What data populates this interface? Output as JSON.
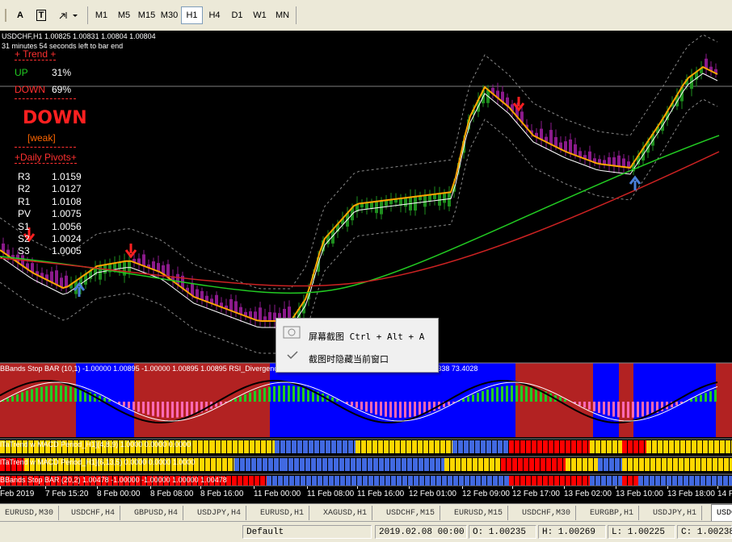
{
  "toolbar": {
    "timeframes": [
      "M1",
      "M5",
      "M15",
      "M30",
      "H1",
      "H4",
      "D1",
      "W1",
      "MN"
    ],
    "selected_timeframe": "H1",
    "text_tool_label": "A",
    "text_label_tool_label": "T"
  },
  "chart": {
    "header": "USDCHF,H1  1.00825 1.00831 1.00804 1.00804",
    "countdown": "31 minutes 54 seconds left to bar end",
    "trend_title": "+  Trend  +",
    "up_label": "UP",
    "up_value": "31%",
    "down_label": "DOWN",
    "down_value": "69%",
    "signal": "DOWN",
    "strength": "[weak]",
    "pivots_title": "+Daily Pivots+",
    "pivots": [
      {
        "name": "R3",
        "value": "1.0159"
      },
      {
        "name": "R2",
        "value": "1.0127"
      },
      {
        "name": "R1",
        "value": "1.0108"
      },
      {
        "name": "PV",
        "value": "1.0075"
      },
      {
        "name": "S1",
        "value": "1.0056"
      },
      {
        "name": "S2",
        "value": "1.0024"
      },
      {
        "name": "S3",
        "value": "1.0005"
      }
    ],
    "indicator_label": "BBands Stop BAR (10,1) -1.00000 1.00895 -1.00000 1.00895 1.00895  RSI_Divergence(7) 0.0000 0.0000 84.3293604  Stoch(8,3,5) 59.6338 73.4028",
    "sub2_label": "lTaTrend w MACD  Period_H1](4,8,9) 1.0000 0.0000 0.0000",
    "sub3_label": "lTaTrend w MACD  Period_H1](6,13,5) 0.0000 0.0000 1.0000",
    "sub4_label": "BBands Stop BAR (20,2) 1.00478 -1.00000 -1.00000 1.00000 1.00478"
  },
  "popup": {
    "item1": "屏幕截图 Ctrl + Alt + A",
    "item2": "截图时隐藏当前窗口"
  },
  "time_axis": [
    "Feb 2019",
    "7 Feb 15:20",
    "8 Feb 00:00",
    "8 Feb 08:00",
    "8 Feb 16:00",
    "11 Feb 00:00",
    "11 Feb 08:00",
    "11 Feb 16:00",
    "12 Feb 01:00",
    "12 Feb 09:00",
    "12 Feb 17:00",
    "13 Feb 02:00",
    "13 Feb 10:00",
    "13 Feb 18:00",
    "14 Fe"
  ],
  "tabs": [
    "EURUSD,M30",
    "USDCHF,H4",
    "GBPUSD,H4",
    "USDJPY,H4",
    "EURUSD,H1",
    "XAGUSD,H1",
    "USDCHF,M15",
    "EURUSD,M15",
    "USDCHF,M30",
    "EURGBP,H1",
    "USDJPY,H1",
    "USDCH"
  ],
  "active_tab": "USDCH",
  "status": {
    "profile": "Default",
    "datetime": "2019.02.08 00:00",
    "open": "O: 1.00235",
    "high": "H: 1.00269",
    "low": "L: 1.00225",
    "close": "C: 1.00238"
  },
  "colors": {
    "up_green": "#22cc22",
    "down_red": "#ff2020",
    "trend_orange": "#ff6600",
    "panel_blue": "#0000ff",
    "panel_red": "#b22222",
    "bar_yellow": "#ffd700",
    "bar_steel": "#4169e1",
    "candle_up": "#1e8f1e",
    "candle_down": "#8b1a8b"
  }
}
